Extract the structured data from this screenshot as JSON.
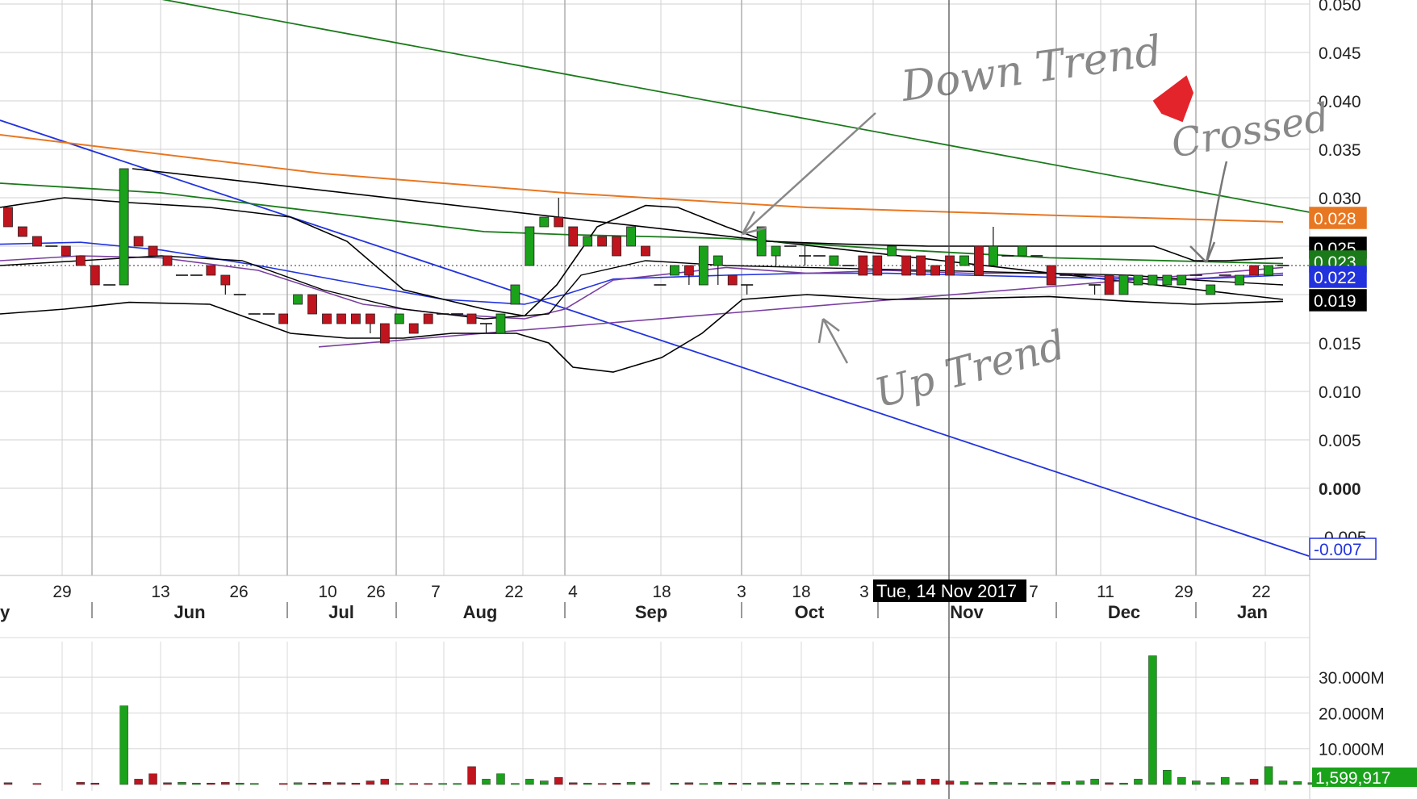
{
  "chart_data": {
    "type": "candlestick",
    "colors": {
      "up": "#1aa21a",
      "down": "#c0141e",
      "sma_orange": "#e87722",
      "sma_green": "#1a7a1a",
      "sma_blue": "#2233dd",
      "sma_purple": "#7a3fa0",
      "bollinger": "#000000",
      "trend_blue": "#2233dd",
      "trend_green": "#1a7a1a",
      "trend_black": "#000000",
      "trend_purple": "#7a3fa0"
    },
    "y_axis": {
      "ylim": [
        -0.009,
        0.05
      ],
      "ticks": [
        "0.050",
        "0.045",
        "0.040",
        "0.035",
        "0.030",
        "0.025",
        "0.020",
        "0.015",
        "0.010",
        "0.005",
        "0.000",
        "-0.005"
      ]
    },
    "x_axis": {
      "day_labels": [
        "29",
        "13",
        "26",
        "10",
        "26",
        "7",
        "22",
        "4",
        "18",
        "3",
        "18",
        "3",
        "7",
        "11",
        "29",
        "22"
      ],
      "month_labels": [
        "y",
        "Jun",
        "Jul",
        "Aug",
        "Sep",
        "Oct",
        "Nov",
        "Dec",
        "Jan"
      ]
    },
    "crosshair": {
      "date": "Tue, 14 Nov 2017"
    },
    "price_badges": [
      {
        "label": "0.028",
        "value": 0.028,
        "color": "#e87722"
      },
      {
        "label": "0.025",
        "value": 0.025,
        "color": "#000000"
      },
      {
        "label": "0.023",
        "value": 0.023,
        "color": "#1a7a1a"
      },
      {
        "label": "0.022",
        "value": 0.022,
        "color": "#2233dd"
      },
      {
        "label": "0.019",
        "value": 0.019,
        "color": "#000000"
      },
      {
        "label": "-0.007",
        "value": -0.007,
        "color": "#2233dd"
      }
    ],
    "candles": [
      [
        0.029,
        0.029,
        0.027,
        0.027
      ],
      [
        0.027,
        0.027,
        0.026,
        0.026
      ],
      [
        0.026,
        0.026,
        0.025,
        0.025
      ],
      [
        0.025,
        0.025,
        0.025,
        0.025
      ],
      [
        0.025,
        0.025,
        0.024,
        0.024
      ],
      [
        0.024,
        0.024,
        0.023,
        0.023
      ],
      [
        0.023,
        0.023,
        0.021,
        0.021
      ],
      [
        0.021,
        0.021,
        0.021,
        0.021
      ],
      [
        0.021,
        0.033,
        0.021,
        0.033
      ],
      [
        0.026,
        0.026,
        0.025,
        0.025
      ],
      [
        0.025,
        0.025,
        0.024,
        0.024
      ],
      [
        0.024,
        0.024,
        0.023,
        0.023
      ],
      [
        0.022,
        0.022,
        0.022,
        0.022
      ],
      [
        0.022,
        0.022,
        0.022,
        0.022
      ],
      [
        0.023,
        0.023,
        0.022,
        0.022
      ],
      [
        0.022,
        0.022,
        0.02,
        0.021
      ],
      [
        0.02,
        0.02,
        0.02,
        0.02
      ],
      [
        0.018,
        0.018,
        0.018,
        0.018
      ],
      [
        0.018,
        0.018,
        0.018,
        0.018
      ],
      [
        0.018,
        0.018,
        0.017,
        0.017
      ],
      [
        0.019,
        0.02,
        0.019,
        0.02
      ],
      [
        0.02,
        0.02,
        0.018,
        0.018
      ],
      [
        0.018,
        0.018,
        0.017,
        0.017
      ],
      [
        0.018,
        0.018,
        0.017,
        0.017
      ],
      [
        0.018,
        0.018,
        0.017,
        0.017
      ],
      [
        0.018,
        0.018,
        0.016,
        0.017
      ],
      [
        0.017,
        0.017,
        0.015,
        0.015
      ],
      [
        0.017,
        0.018,
        0.017,
        0.018
      ],
      [
        0.017,
        0.017,
        0.016,
        0.016
      ],
      [
        0.018,
        0.018,
        0.017,
        0.017
      ],
      [
        0.018,
        0.018,
        0.018,
        0.018
      ],
      [
        0.018,
        0.018,
        0.018,
        0.018
      ],
      [
        0.018,
        0.018,
        0.017,
        0.017
      ],
      [
        0.017,
        0.017,
        0.016,
        0.017
      ],
      [
        0.016,
        0.018,
        0.016,
        0.018
      ],
      [
        0.019,
        0.021,
        0.019,
        0.021
      ],
      [
        0.023,
        0.027,
        0.023,
        0.027
      ],
      [
        0.027,
        0.028,
        0.027,
        0.028
      ],
      [
        0.028,
        0.03,
        0.027,
        0.027
      ],
      [
        0.027,
        0.027,
        0.025,
        0.025
      ],
      [
        0.025,
        0.026,
        0.025,
        0.026
      ],
      [
        0.026,
        0.026,
        0.025,
        0.025
      ],
      [
        0.026,
        0.026,
        0.024,
        0.024
      ],
      [
        0.025,
        0.027,
        0.025,
        0.027
      ],
      [
        0.025,
        0.025,
        0.024,
        0.024
      ],
      [
        0.021,
        0.021,
        0.021,
        0.021
      ],
      [
        0.022,
        0.023,
        0.022,
        0.023
      ],
      [
        0.023,
        0.023,
        0.021,
        0.022
      ],
      [
        0.021,
        0.025,
        0.021,
        0.025
      ],
      [
        0.023,
        0.024,
        0.021,
        0.024
      ],
      [
        0.022,
        0.022,
        0.021,
        0.021
      ],
      [
        0.021,
        0.021,
        0.02,
        0.021
      ],
      [
        0.024,
        0.027,
        0.024,
        0.027
      ],
      [
        0.024,
        0.025,
        0.023,
        0.025
      ],
      [
        0.025,
        0.025,
        0.025,
        0.025
      ],
      [
        0.024,
        0.025,
        0.023,
        0.024
      ],
      [
        0.024,
        0.024,
        0.024,
        0.024
      ],
      [
        0.023,
        0.024,
        0.023,
        0.024
      ],
      [
        0.023,
        0.023,
        0.023,
        0.023
      ],
      [
        0.024,
        0.024,
        0.022,
        0.022
      ],
      [
        0.024,
        0.024,
        0.022,
        0.022
      ],
      [
        0.024,
        0.025,
        0.024,
        0.025
      ],
      [
        0.024,
        0.024,
        0.022,
        0.022
      ],
      [
        0.024,
        0.024,
        0.022,
        0.022
      ],
      [
        0.023,
        0.023,
        0.022,
        0.022
      ],
      [
        0.024,
        0.024,
        0.022,
        0.022
      ],
      [
        0.023,
        0.024,
        0.023,
        0.024
      ],
      [
        0.025,
        0.025,
        0.022,
        0.022
      ],
      [
        0.023,
        0.027,
        0.023,
        0.025
      ],
      [
        0.024,
        0.024,
        0.024,
        0.024
      ],
      [
        0.024,
        0.025,
        0.024,
        0.025
      ],
      [
        0.024,
        0.024,
        0.024,
        0.024
      ],
      [
        0.023,
        0.023,
        0.021,
        0.021
      ],
      [
        0.022,
        0.022,
        0.022,
        0.022
      ],
      [
        0.022,
        0.022,
        0.022,
        0.022
      ],
      [
        0.021,
        0.021,
        0.02,
        0.021
      ],
      [
        0.022,
        0.022,
        0.02,
        0.02
      ],
      [
        0.02,
        0.022,
        0.02,
        0.022
      ],
      [
        0.021,
        0.022,
        0.021,
        0.022
      ],
      [
        0.021,
        0.022,
        0.021,
        0.022
      ],
      [
        0.021,
        0.022,
        0.021,
        0.022
      ],
      [
        0.021,
        0.022,
        0.021,
        0.022
      ],
      [
        0.022,
        0.022,
        0.022,
        0.022
      ],
      [
        0.02,
        0.021,
        0.02,
        0.021
      ],
      [
        0.022,
        0.022,
        0.022,
        0.022
      ],
      [
        0.021,
        0.022,
        0.021,
        0.022
      ],
      [
        0.023,
        0.023,
        0.022,
        0.022
      ],
      [
        0.022,
        0.023,
        0.022,
        0.023
      ],
      [
        0.023,
        0.023,
        0.023,
        0.023
      ]
    ],
    "volume_axis": {
      "ticks": [
        "30.000M",
        "20.000M",
        "10.000M"
      ],
      "last_value": "1,599,917"
    },
    "volumes": [
      0.5,
      0,
      0.3,
      0,
      0,
      0.6,
      0.4,
      0,
      22.0,
      1.5,
      3.0,
      0.5,
      0.6,
      0.4,
      0.4,
      0.6,
      0.4,
      0.3,
      0,
      0.3,
      0.5,
      0.4,
      0.6,
      0.5,
      0.4,
      1.0,
      1.5,
      0.3,
      0.3,
      0.3,
      0.3,
      0.3,
      5.0,
      1.5,
      3.0,
      0.3,
      1.5,
      1.0,
      2.0,
      0.5,
      0.4,
      0.3,
      0.4,
      0.6,
      0.5,
      0,
      0.4,
      0.5,
      0.3,
      0.6,
      0.4,
      0.4,
      0.5,
      0.6,
      0.4,
      0.4,
      0.3,
      0.4,
      0.6,
      0.5,
      0.4,
      0.5,
      1.0,
      1.5,
      1.5,
      1.0,
      0.8,
      0.5,
      0.6,
      0.5,
      0.4,
      0.5,
      0.6,
      0.8,
      1.0,
      1.5,
      0.5,
      0.4,
      1.5,
      36.0,
      4.0,
      2.0,
      1.0,
      0.5,
      2.0,
      0.5,
      1.5,
      5.0,
      1.0,
      0.8,
      0.5,
      1.6
    ],
    "annotations": {
      "down_trend": "Down Trend",
      "up_trend": "Up Trend",
      "crossed": "Crossed"
    }
  }
}
